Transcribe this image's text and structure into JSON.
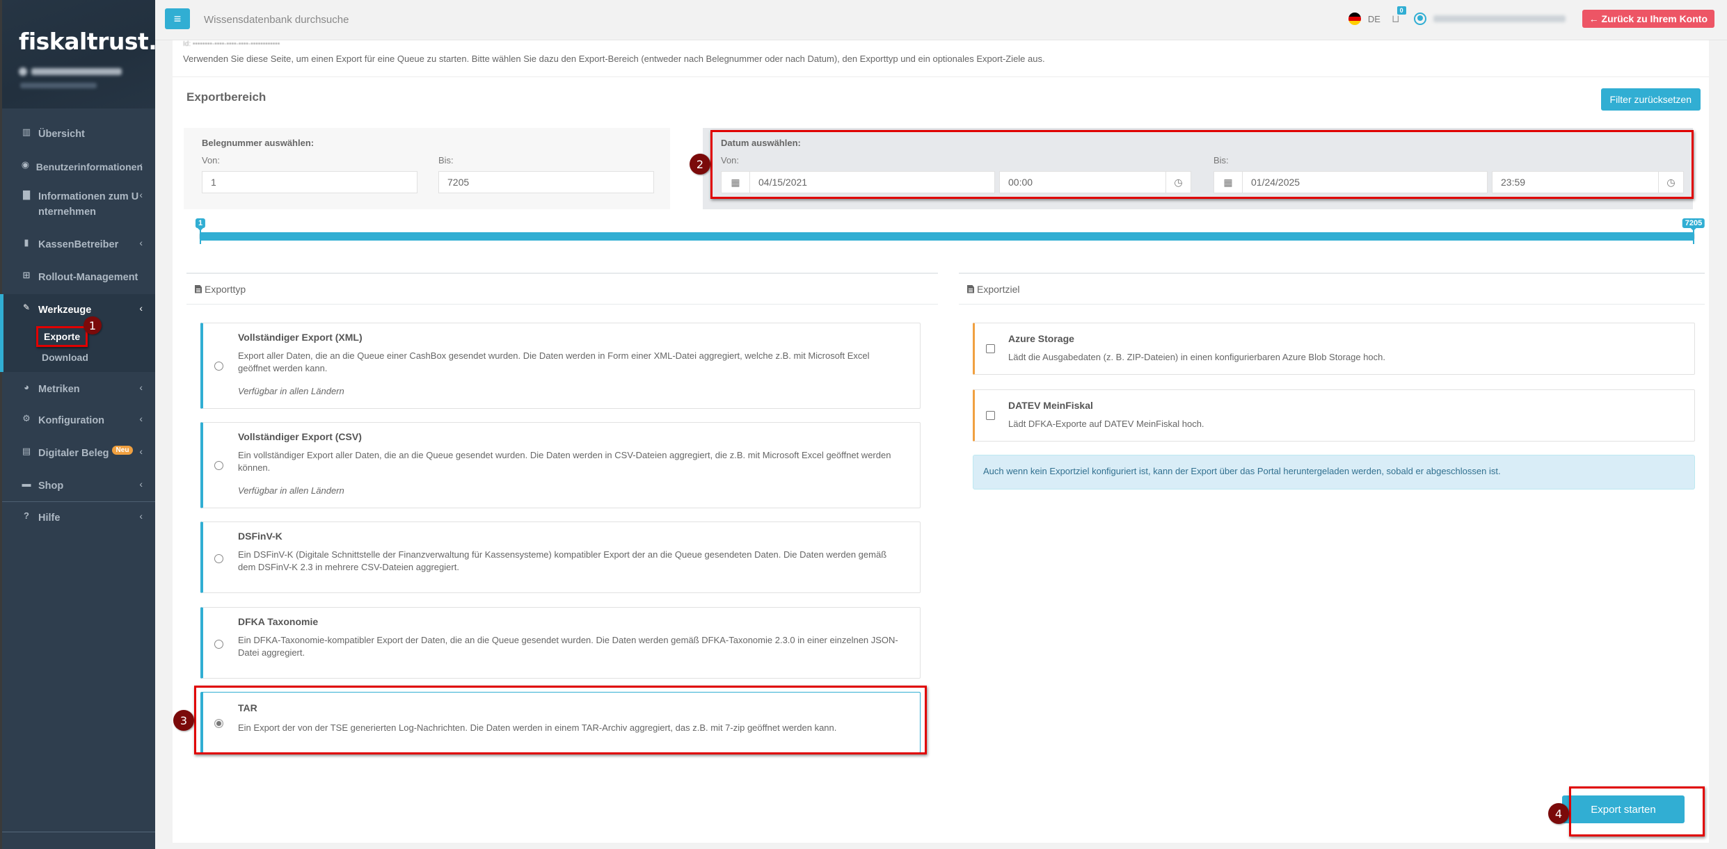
{
  "sidebar": {
    "brand": "fiskaltrust.",
    "items": [
      {
        "label": "Übersicht",
        "icon": "bar-chart-icon",
        "glyph": "▥",
        "chevron": ""
      },
      {
        "label": "Benutzerinformationen",
        "icon": "user-circle-icon",
        "glyph": "◉",
        "chevron": "‹"
      },
      {
        "label": "Informationen zum Unternehmen",
        "icon": "briefcase-icon",
        "glyph": "▇",
        "chevron": "‹"
      },
      {
        "label": "KassenBetreiber",
        "icon": "register-icon",
        "glyph": "▮",
        "chevron": "‹"
      },
      {
        "label": "Rollout-Management",
        "icon": "plus-square-icon",
        "glyph": "⊞",
        "chevron": ""
      },
      {
        "label": "Werkzeuge",
        "icon": "wrench-icon",
        "glyph": "🔧",
        "chevron": "‹"
      },
      {
        "label": "Metriken",
        "icon": "pie-chart-icon",
        "glyph": "◕",
        "chevron": "‹"
      },
      {
        "label": "Konfiguration",
        "icon": "cogs-icon",
        "glyph": "⚙",
        "chevron": "‹"
      },
      {
        "label": "Digitaler Beleg",
        "icon": "file-icon",
        "glyph": "▤",
        "chevron": "‹",
        "badge": "Neu"
      },
      {
        "label": "Shop",
        "icon": "credit-card-icon",
        "glyph": "▬",
        "chevron": "‹"
      },
      {
        "label": "Hilfe",
        "icon": "question-circle-icon",
        "glyph": "?",
        "chevron": "‹"
      }
    ],
    "subitems": [
      {
        "label": "Exporte"
      },
      {
        "label": "Download"
      }
    ]
  },
  "topbar": {
    "menu_glyph": "≡",
    "search_placeholder": "Wissensdatenbank durchsuche",
    "language": "DE",
    "cart_count": "0",
    "cart_glyph": "🧺",
    "back_button": "Zurück zu Ihrem Konto",
    "back_arrow": "🡐"
  },
  "page": {
    "intro": "Verwenden Sie diese Seite, um einen Export für eine Queue zu starten. Bitte wählen Sie dazu den Export-Bereich (entweder nach Belegnummer oder nach Datum), den Exporttyp und ein optionales Export-Ziele aus."
  },
  "range": {
    "title": "Exportbereich",
    "reset_button": "Filter zurücksetzen",
    "receipt": {
      "title": "Belegnummer auswählen:",
      "from_label": "Von:",
      "from_value": "1",
      "to_label": "Bis:",
      "to_value": "7205"
    },
    "date": {
      "title": "Datum auswählen:",
      "from_label": "Von:",
      "from_date": "04/15/2021",
      "from_time": "00:00",
      "to_label": "Bis:",
      "to_date": "01/24/2025",
      "to_time": "23:59"
    },
    "slider": {
      "min": 1,
      "max": 7205,
      "low": 1,
      "high": 7205,
      "low_label": "1",
      "high_label": "7205"
    }
  },
  "export_type": {
    "header": "Exporttyp",
    "options": [
      {
        "title": "Vollständiger Export (XML)",
        "desc": "Export aller Daten, die an die Queue einer CashBox gesendet wurden. Die Daten werden in Form einer XML-Datei aggregiert, welche z.B. mit Microsoft Excel geöffnet werden kann.",
        "note": "Verfügbar in allen Ländern",
        "selected": false
      },
      {
        "title": "Vollständiger Export (CSV)",
        "desc": "Ein vollständiger Export aller Daten, die an die Queue gesendet wurden. Die Daten werden in CSV-Dateien aggregiert, die z.B. mit Microsoft Excel geöffnet werden können.",
        "note": "Verfügbar in allen Ländern",
        "selected": false
      },
      {
        "title": "DSFinV-K",
        "desc": "Ein DSFinV-K (Digitale Schnittstelle der Finanzverwaltung für Kassensysteme) kompatibler Export der an die Queue gesendeten Daten. Die Daten werden gemäß dem DSFinV-K 2.3 in mehrere CSV-Dateien aggregiert.",
        "note": "",
        "selected": false
      },
      {
        "title": "DFKA Taxonomie",
        "desc": "Ein DFKA-Taxonomie-kompatibler Export der Daten, die an die Queue gesendet wurden. Die Daten werden gemäß DFKA-Taxonomie 2.3.0 in einer einzelnen JSON-Datei aggregiert.",
        "note": "",
        "selected": false
      },
      {
        "title": "TAR",
        "desc": "Ein Export der von der TSE generierten Log-Nachrichten. Die Daten werden in einem TAR-Archiv aggregiert, das z.B. mit 7-zip geöffnet werden kann.",
        "note": "",
        "selected": true
      }
    ]
  },
  "export_target": {
    "header": "Exportziel",
    "options": [
      {
        "title": "Azure Storage",
        "desc": "Lädt die Ausgabedaten (z. B. ZIP-Dateien) in einen konfigurierbaren Azure Blob Storage hoch.",
        "checked": false
      },
      {
        "title": "DATEV MeinFiskal",
        "desc": "Lädt DFKA-Exporte auf DATEV MeinFiskal hoch.",
        "checked": false
      }
    ],
    "info": "Auch wenn kein Exportziel konfiguriert ist, kann der Export über das Portal heruntergeladen werden, sobald er abgeschlossen ist."
  },
  "actions": {
    "start_export": "Export starten"
  },
  "annotations": [
    "1",
    "2",
    "3",
    "4"
  ],
  "colors": {
    "accent": "#31aed3",
    "sidebar": "#2f3e4e",
    "danger": "#ed5565",
    "target_border": "#f0a040",
    "annotation": "#7b0a0a",
    "highlight_box": "#e00000"
  }
}
